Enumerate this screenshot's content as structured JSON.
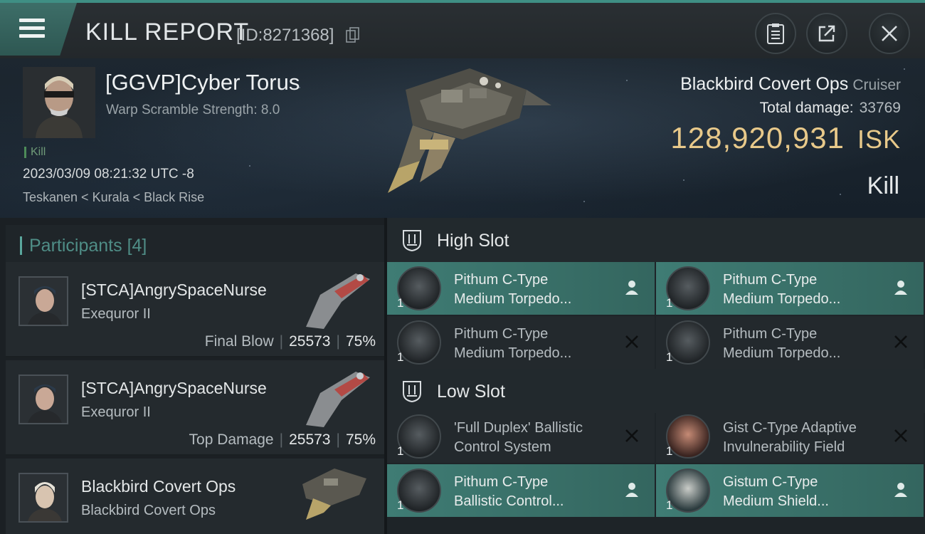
{
  "header": {
    "title": "KILL REPORT",
    "report_id": "[ID:8271368]"
  },
  "victim": {
    "name": "[GGVP]Cyber Torus",
    "warp_scramble": "Warp Scramble Strength: 8.0",
    "tag": "Kill",
    "time": "2023/03/09 08:21:32 UTC -8",
    "location": "Teskanen < Kurala < Black Rise",
    "ship": "Blackbird Covert Ops",
    "ship_class": "Cruiser",
    "total_damage_label": "Total damage:",
    "total_damage": "33769",
    "isk_value": "128,920,931",
    "isk_unit": "ISK",
    "result": "Kill"
  },
  "participants": {
    "label": "Participants",
    "count": "[4]",
    "rows": [
      {
        "name": "[STCA]AngrySpaceNurse",
        "ship": "Exequror II",
        "role": "Final Blow",
        "damage": "25573",
        "percent": "75%"
      },
      {
        "name": "[STCA]AngrySpaceNurse",
        "ship": "Exequror II",
        "role": "Top Damage",
        "damage": "25573",
        "percent": "75%"
      },
      {
        "name": "Blackbird Covert Ops",
        "ship": "Blackbird Covert Ops"
      }
    ]
  },
  "slots": {
    "high": {
      "label": "High Slot",
      "modules": [
        {
          "line1": "Pithum C-Type",
          "line2": "Medium Torpedo...",
          "qty": "1",
          "state": "fitted"
        },
        {
          "line1": "Pithum C-Type",
          "line2": "Medium Torpedo...",
          "qty": "1",
          "state": "fitted"
        },
        {
          "line1": "Pithum C-Type",
          "line2": "Medium Torpedo...",
          "qty": "1",
          "state": "destroyed"
        },
        {
          "line1": "Pithum C-Type",
          "line2": "Medium Torpedo...",
          "qty": "1",
          "state": "destroyed"
        }
      ]
    },
    "low": {
      "label": "Low Slot",
      "modules": [
        {
          "line1": "'Full Duplex' Ballistic",
          "line2": "Control System",
          "qty": "1",
          "state": "destroyed"
        },
        {
          "line1": "Gist C-Type Adaptive",
          "line2": "Invulnerability Field",
          "qty": "1",
          "state": "destroyed"
        },
        {
          "line1": "Pithum C-Type",
          "line2": "Ballistic Control...",
          "qty": "1",
          "state": "fitted"
        },
        {
          "line1": "Gistum C-Type",
          "line2": "Medium Shield...",
          "qty": "1",
          "state": "fitted"
        }
      ]
    }
  },
  "colors": {
    "accent": "#3f8f84",
    "fitted": "#3f7c74",
    "isk": "#e8c98a"
  }
}
